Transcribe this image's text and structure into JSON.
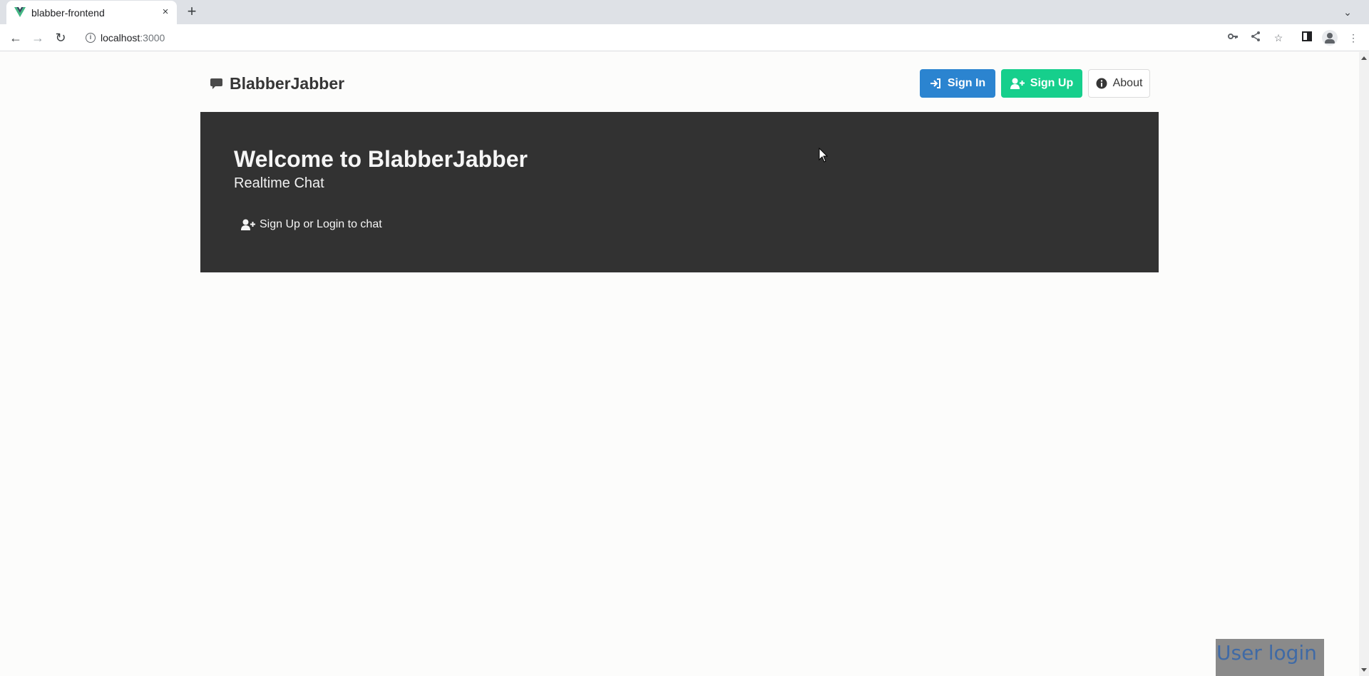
{
  "browser": {
    "tab_title": "blabber-frontend",
    "tab_close": "×",
    "new_tab": "+",
    "url_host": "localhost",
    "url_port": ":3000"
  },
  "navbar": {
    "brand": "BlabberJabber",
    "signin_label": "Sign In",
    "signup_label": "Sign Up",
    "about_label": "About"
  },
  "hero": {
    "title": "Welcome to BlabberJabber",
    "subtitle": "Realtime Chat",
    "cta": "Sign Up or Login to chat"
  },
  "overlay": {
    "label": "User login"
  },
  "colors": {
    "signin": "#2b84d0",
    "signup": "#16cf8c",
    "hero_bg": "#323232",
    "favicon": "#41b883"
  },
  "icons": {
    "brand": "comment-icon",
    "signin": "sign-in-icon",
    "signup": "user-plus-icon",
    "about": "info-circle-icon"
  }
}
